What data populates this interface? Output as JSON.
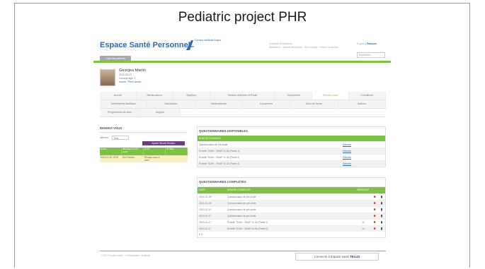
{
  "slide_title": "Pediatric project PHR",
  "header": {
    "brand": "Espace Santé Personnel",
    "logo_text": "Clinique médicale Angus",
    "top_links": [
      "Contacter le bénévole",
      "Bienvenue : Joanne (bénévole)"
    ],
    "account_links": [
      "Mon compte",
      "Fermer la session"
    ],
    "lang_label": "English",
    "lang_sep": " | ",
    "lang_active": "Français",
    "search_placeholder": "Recherche",
    "patients_button": "Liste des patients"
  },
  "patient": {
    "name": "Georges Martin",
    "dob": "2012-02-07",
    "age": "Homme âge: 1",
    "access": "Accès : Plein accès"
  },
  "tabs_row1": [
    "Accueil",
    "Mensurations",
    "Système",
    "Tension artérielle et Pouls",
    "Glucomètre",
    "Rendez-vous",
    "Conditions"
  ],
  "tabs_row2": [
    "Antécédents familiaux",
    "Vaccination",
    "Médicaments",
    "Documents",
    "Suivi de Santé",
    "Asthme"
  ],
  "tabs_row3": [
    "Programmes de suivi",
    "Support"
  ],
  "active_tab": "Rendez-vous",
  "rendezvous": {
    "title": "RENDEZ-VOUS",
    "filter_label": "Afficher :",
    "filter_value": "Tous",
    "add_button": "Ajouter Nouvel Rendez-",
    "columns": [
      "DATE",
      "RENDEZ-VOUS AVEC",
      "ÉTAT",
      "NOTES"
    ],
    "rows": [
      {
        "date": "2014-01-20 10:00",
        "with": "Dre Patricia",
        "state": "Rendez-vous à venir",
        "notes": ""
      }
    ]
  },
  "questionnaires_dispo": {
    "title": "QUESTIONNAIRES DISPONIBLES",
    "header": "NOM DE CONSULTE",
    "rows": [
      {
        "name": "Questionnaire de pré-visite",
        "action": "Débuter"
      },
      {
        "name": "Échelle TDAH - SNAP-IV-26 (Partie 1)",
        "action": "Débuter"
      },
      {
        "name": "Échelle TDAH - SNAP-IV-26 (Partie 2)",
        "action": "Débuter"
      },
      {
        "name": "Échelle TDAH - SNAP-IV-26 (Partie 3)",
        "action": "Débuter"
      }
    ]
  },
  "questionnaires_completes": {
    "title": "QUESTIONNAIRES COMPLÉTÉS",
    "columns": [
      "DATE",
      "NOM DE CONSULTE",
      "RÉSULTAT TOTAL",
      "",
      ""
    ],
    "rows": [
      {
        "date": "2014-01-09",
        "name": "Questionnaire de pré-visite",
        "score": ""
      },
      {
        "date": "2014-01-08",
        "name": "Questionnaire de pré-visite",
        "score": ""
      },
      {
        "date": "2013-12-19",
        "name": "Questionnaire de pré-visite",
        "score": ""
      },
      {
        "date": "2013-12-17",
        "name": "Questionnaire de pré-visite",
        "score": ""
      },
      {
        "date": "2013-12-17",
        "name": "Échelle TDAH - SNAP-IV-26 (Partie 1)",
        "score": "14"
      },
      {
        "date": "2013-12-17",
        "name": "Échelle TDAH - SNAP-IV-26 (Partie 2)",
        "score": "16"
      }
    ],
    "pagination": "« 1"
  },
  "footer": {
    "copyright": "© 2014 Espace santé · Confidentialité · Juridique",
    "telus_prefix": "Connecté à Espace santé ",
    "telus_brand": "TELUS"
  },
  "colors": {
    "accent_green": "#7dc243",
    "brand_blue": "#2b6cb0",
    "purple": "#6a3f88"
  }
}
